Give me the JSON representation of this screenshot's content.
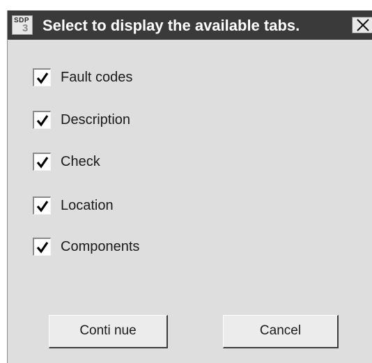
{
  "window": {
    "title": "Select to display the available tabs.",
    "icon": {
      "top_text": "SDP",
      "bottom_text": "3",
      "name": "sdp3-app-icon"
    },
    "close_icon": "close-icon"
  },
  "options": [
    {
      "label": "Fault codes",
      "checked": true
    },
    {
      "label": "Description",
      "checked": true
    },
    {
      "label": "Check",
      "checked": true
    },
    {
      "label": "Location",
      "checked": true
    },
    {
      "label": "Components",
      "checked": true
    }
  ],
  "buttons": {
    "continue_label": "Conti nue",
    "cancel_label": "Cancel"
  },
  "colors": {
    "titlebar": "#3a3a3a",
    "dialog_background": "#dedede",
    "check_mark": "#000000"
  }
}
